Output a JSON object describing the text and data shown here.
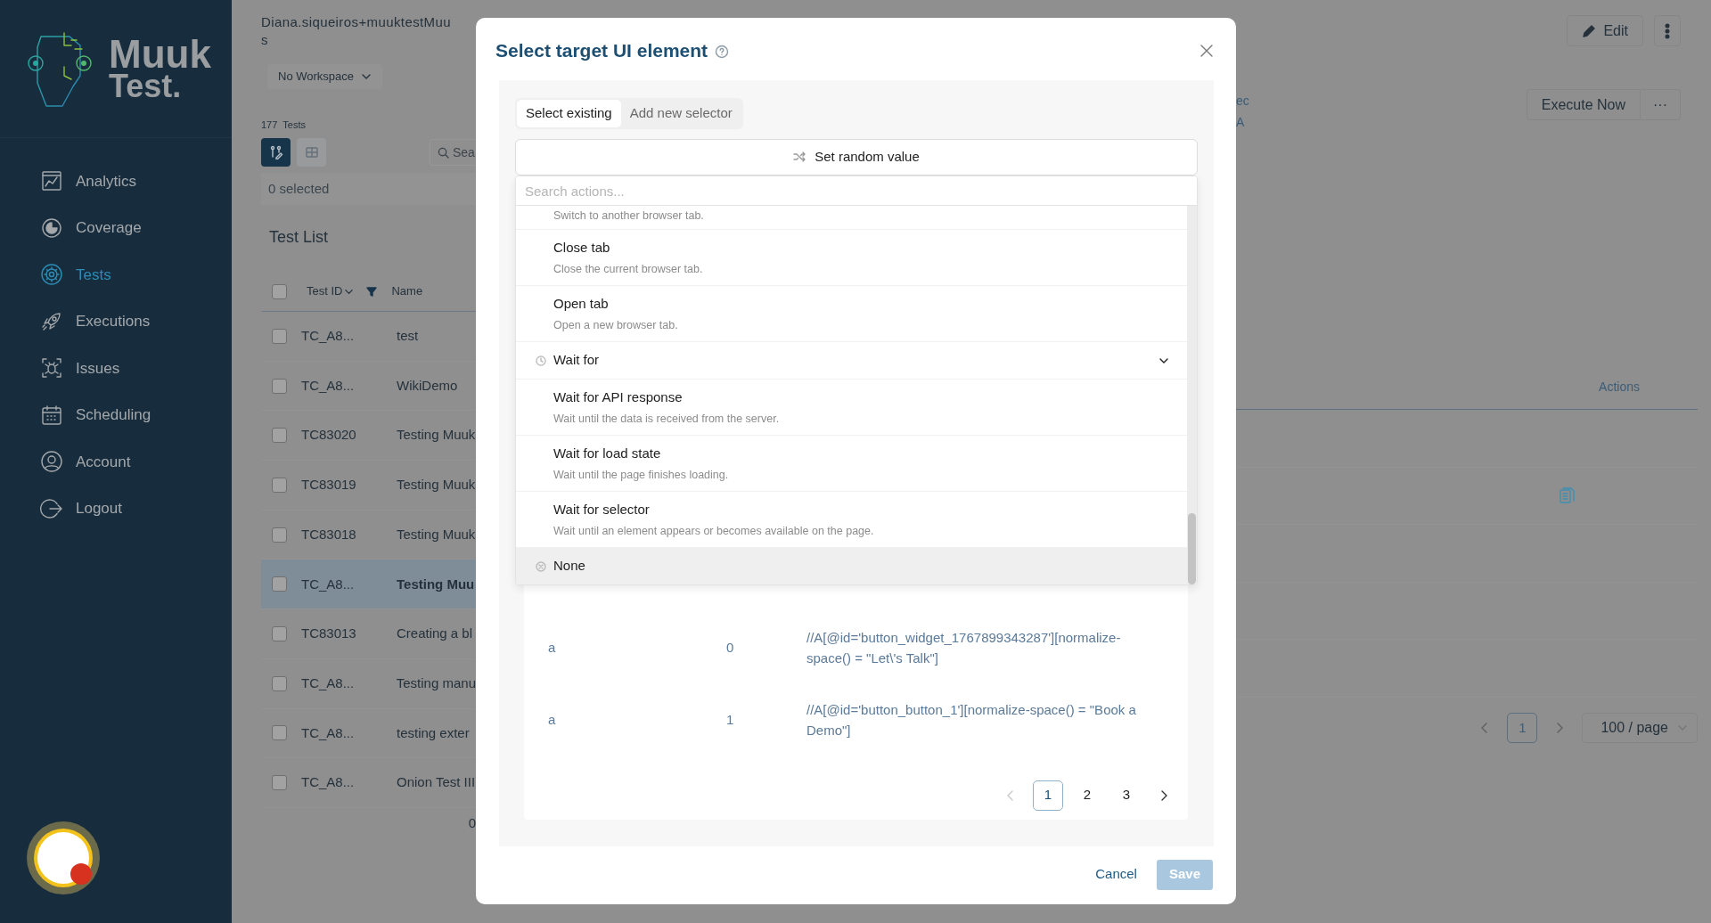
{
  "sidebar": {
    "brand": [
      "Muuk",
      "Test."
    ],
    "items": [
      {
        "label": "Analytics",
        "selected": false
      },
      {
        "label": "Coverage",
        "selected": false
      },
      {
        "label": "Tests",
        "selected": true
      },
      {
        "label": "Executions",
        "selected": false
      },
      {
        "label": "Issues",
        "selected": false
      },
      {
        "label": "Scheduling",
        "selected": false
      },
      {
        "label": "Account",
        "selected": false
      },
      {
        "label": "Logout",
        "selected": false
      }
    ]
  },
  "header": {
    "account_lines": [
      "Diana.siqueiros+muuktestMuu",
      "s"
    ],
    "workspace": "No Workspace",
    "tests_count": "177",
    "tests_label": "Tests",
    "view_toggles": [
      {
        "selected": true
      },
      {
        "selected": false
      }
    ],
    "search": {
      "placeholder": "Sea"
    },
    "selection": "0 selected"
  },
  "test_list": {
    "title": "Test List",
    "columns": [
      "Test ID",
      "Name"
    ],
    "select_all_checked": false,
    "rows": [
      {
        "id": "TC_A8...",
        "name": "test",
        "checked": false,
        "selected": false
      },
      {
        "id": "TC_A8...",
        "name": "WikiDemo",
        "checked": false,
        "selected": false
      },
      {
        "id": "TC83020",
        "name": "Testing Muuk",
        "checked": false,
        "selected": false
      },
      {
        "id": "TC83019",
        "name": "Testing Muuk",
        "checked": false,
        "selected": false
      },
      {
        "id": "TC83018",
        "name": "Testing Muuk",
        "checked": false,
        "selected": false
      },
      {
        "id": "TC_A8...",
        "name": "Testing Muu",
        "checked": false,
        "selected": true
      },
      {
        "id": "TC83013",
        "name": "Creating a bl",
        "checked": false,
        "selected": false
      },
      {
        "id": "TC_A8...",
        "name": "Testing manu",
        "checked": false,
        "selected": false
      },
      {
        "id": "TC_A8...",
        "name": "testing exter",
        "checked": false,
        "selected": false
      },
      {
        "id": "TC_A8...",
        "name": "Onion Test III",
        "checked": false,
        "selected": false
      }
    ],
    "footer": "0"
  },
  "detail": {
    "edit": "Edit",
    "fragments": [
      "ec",
      "A"
    ],
    "execute": "Execute Now",
    "execute_more": "···",
    "actions_column": "Actions",
    "pagination": {
      "prev_disabled": true,
      "next_disabled": true,
      "pages": [
        {
          "label": "1",
          "selected": true
        }
      ],
      "page_size": "100 / page"
    }
  },
  "modal": {
    "title": "Select target UI element",
    "tabs": [
      {
        "label": "Select existing",
        "selected": true
      },
      {
        "label": "Add new selector",
        "selected": false
      }
    ],
    "random_button": "Set random value",
    "search": {
      "placeholder": "Search actions..."
    },
    "actions": [
      {
        "kind": "item",
        "description": "Switch to another browser tab.",
        "highlighted": false
      },
      {
        "kind": "item",
        "title": "Close tab",
        "description": "Close the current browser tab.",
        "highlighted": false
      },
      {
        "kind": "item",
        "title": "Open tab",
        "description": "Open a new browser tab.",
        "highlighted": false
      },
      {
        "kind": "group",
        "title": "Wait for",
        "expanded": true,
        "highlighted": false
      },
      {
        "kind": "item",
        "title": "Wait for API response",
        "description": "Wait until the data is received from the server.",
        "highlighted": false
      },
      {
        "kind": "item",
        "title": "Wait for load state",
        "description": "Wait until the page finishes loading.",
        "highlighted": false
      },
      {
        "kind": "item",
        "title": "Wait for selector",
        "description": "Wait until an element appears or becomes available on the page.",
        "highlighted": false
      },
      {
        "kind": "none",
        "title": "None",
        "highlighted": true
      }
    ],
    "selectors": [
      {
        "tag": "a",
        "index": "0",
        "xpath": "//A[@id='button_widget_1767899343287'][normalize-space() = \"Let\\'s Talk\"]"
      },
      {
        "tag": "a",
        "index": "1",
        "xpath": "//A[@id='button_button_1'][normalize-space() = \"Book a Demo\"]"
      }
    ],
    "pagination": {
      "prev_disabled": true,
      "next_disabled": false,
      "pages": [
        {
          "label": "1",
          "selected": true
        },
        {
          "label": "2",
          "selected": false
        },
        {
          "label": "3",
          "selected": false
        }
      ]
    },
    "cancel": "Cancel",
    "save": {
      "label": "Save",
      "disabled": true
    }
  }
}
